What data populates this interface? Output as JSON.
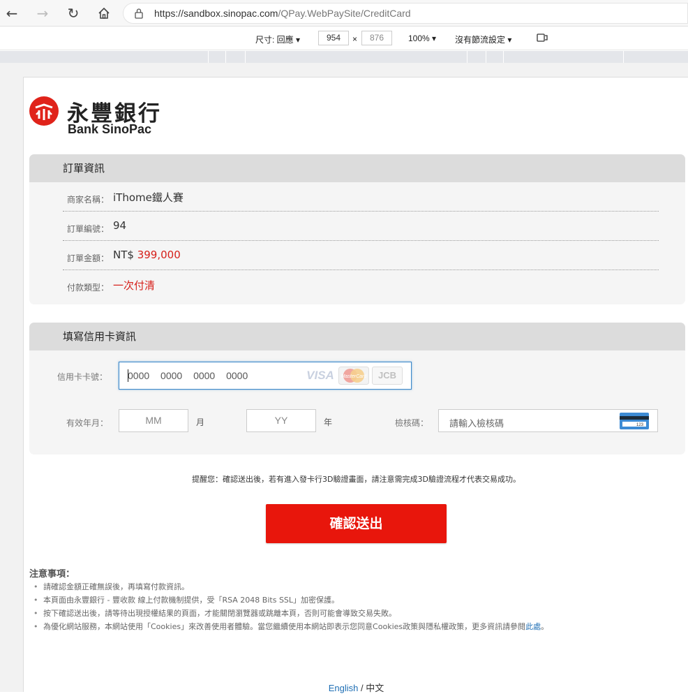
{
  "browser": {
    "url_host": "https://sandbox.sinopac.com",
    "url_path": "/QPay.WebPaySite/CreditCard"
  },
  "device_toolbar": {
    "dimensions_label": "尺寸: 回應",
    "width": "954",
    "times": "×",
    "height": "876",
    "zoom": "100%",
    "throttling": "沒有節流設定"
  },
  "logo": {
    "cn": "永豐銀行",
    "en": "Bank SinoPac",
    "brand_color": "#e0231a"
  },
  "order": {
    "heading": "訂單資訊",
    "rows": [
      {
        "label": "商家名稱：",
        "value": "iThome鐵人賽"
      },
      {
        "label": "訂單編號：",
        "value": "94"
      },
      {
        "label": "訂單金額：",
        "currency": "NT$",
        "value": "399,000"
      },
      {
        "label": "付款類型：",
        "value": "一次付清"
      }
    ]
  },
  "card": {
    "heading": "填寫信用卡資訊",
    "number_label": "信用卡卡號：",
    "number_placeholder": "0000 0000 0000 0000",
    "expiry_label": "有效年月：",
    "month_placeholder": "MM",
    "month_unit": "月",
    "year_placeholder": "YY",
    "year_unit": "年",
    "cvv_label": "檢核碼：",
    "cvv_placeholder": "請輸入檢核碼",
    "brands": {
      "visa": "VISA",
      "mastercard": "MasterCard",
      "jcb": "JCB"
    }
  },
  "reminder": "提醒您：確認送出後，若有進入發卡行3D驗證畫面，請注意需完成3D驗證流程才代表交易成功。",
  "submit_label": "確認送出",
  "notice": {
    "title": "注意事項：",
    "items": [
      "請確認金額正確無誤後，再填寫付款資訊。",
      "本頁面由永豐銀行 - 豐收款 線上付款機制提供，受「RSA 2048 Bits SSL」加密保護。",
      "按下確認送出後，請等待出現授權結果的頁面，才能關閉瀏覽器或跳離本頁，否則可能會導致交易失敗。",
      "為優化網站服務，本網站使用「Cookies」來改善使用者體驗。當您繼續使用本網站即表示您同意Cookies政策與隱私權政策，更多資訊請參閱"
    ],
    "link_text": "此處",
    "link_suffix": "。"
  },
  "language": {
    "english": "English",
    "separator": " / ",
    "chinese": "中文"
  }
}
